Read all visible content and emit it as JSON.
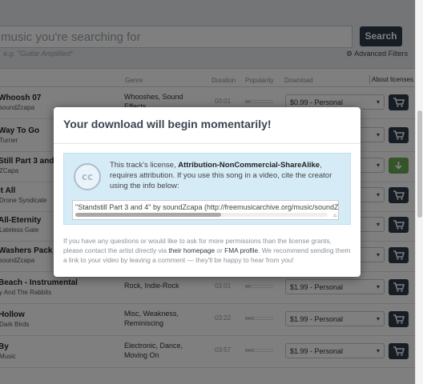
{
  "search": {
    "placeholder": "music you're searching for",
    "button_label": "Search",
    "hint": "e.g. \"Guitar Amplified\"",
    "advanced_filters": "Advanced Filters"
  },
  "columns": {
    "genre": "Genre",
    "duration": "Duration",
    "popularity": "Popularity",
    "download": "Download",
    "about_licenses": "About licenses"
  },
  "tracks": [
    {
      "title": "Whoosh 07",
      "artist": "soundZcapa",
      "genre": "Whooshes, Sound Effects",
      "duration": "00:01",
      "popularity": 0.2,
      "license": "$0.99 - Personal",
      "cart": "cart"
    },
    {
      "title": "Way To Go",
      "artist": "Turner",
      "genre": "",
      "duration": "",
      "popularity": 0.3,
      "license": "",
      "cart": "cart"
    },
    {
      "title": "Still Part 3 and 4",
      "artist": "ZCapa",
      "genre": "",
      "duration": "",
      "popularity": 0.3,
      "license": "",
      "cart": "download"
    },
    {
      "title": "It All",
      "artist": "Drone Syndicate",
      "genre": "",
      "duration": "",
      "popularity": 0.3,
      "license": "",
      "cart": "cart"
    },
    {
      "title": "All-Eternity",
      "artist": "Lateless Gate",
      "genre": "",
      "duration": "",
      "popularity": 0.3,
      "license": "",
      "cart": "cart"
    },
    {
      "title": "Washers Pack 65",
      "artist": "soundZcapa",
      "genre": "",
      "duration": "",
      "popularity": 0.3,
      "license": "",
      "cart": "cart"
    },
    {
      "title": "Beach - Instrumental",
      "artist": "y And The Rabbits",
      "genre": "Rock, Indie-Rock",
      "duration": "03:01",
      "popularity": 0.2,
      "license": "$1.99 - Personal",
      "cart": "cart"
    },
    {
      "title": "Hollow",
      "artist": "Dark Birds",
      "genre": "Misc, Weakness, Reminiscing",
      "duration": "03:22",
      "popularity": 0.3,
      "license": "$1.99 - Personal",
      "cart": "cart"
    },
    {
      "title": "By",
      "artist": "Music",
      "genre": "Electronic, Dance, Moving On",
      "duration": "03:57",
      "popularity": 0.3,
      "license": "$1.99 - Personal",
      "cart": "cart"
    }
  ],
  "modal": {
    "title": "Your download will begin momentarily!",
    "cc_label": "cc",
    "license_intro": "This track's license,",
    "license_name": "Attribution-NonCommercial-ShareAlike",
    "license_rest": ", requires attribution. If you use this song in a video, cite the creator using the info below:",
    "credit": "\"Standstill Part 3 and 4\" by soundZcapa (http://freemusicarchive.org/music/soundZcapa/)",
    "help_1": "If you have any questions or would like to ask for more permissions than the license grants, please contact the artist directly via",
    "homepage_link": "their homepage",
    "help_or": "or",
    "fma_link": "FMA profile",
    "help_2": ". We recommend sending them a link to your video by leaving a comment — they'll be happy to hear from you!"
  }
}
